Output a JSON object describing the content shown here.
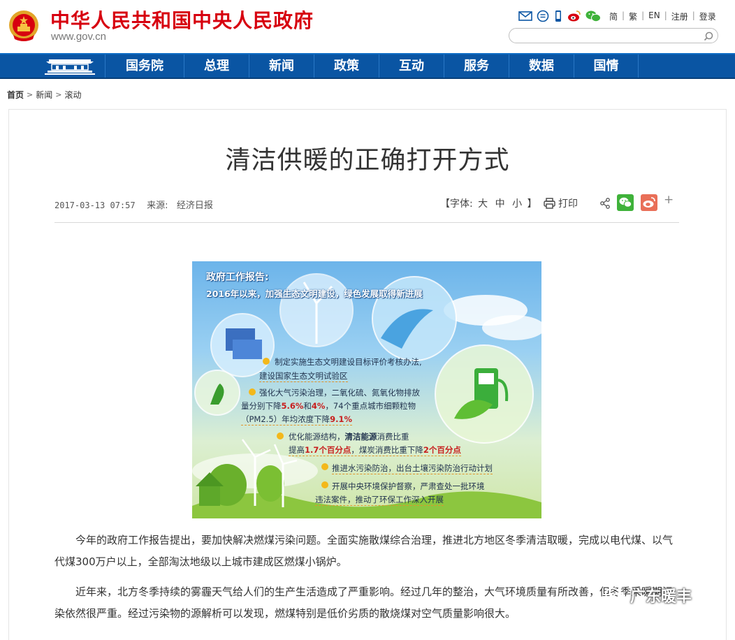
{
  "header": {
    "site_title": "中华人民共和国中央人民政府",
    "site_domain": "www.gov.cn",
    "lang_links": [
      "简",
      "繁",
      "EN",
      "注册",
      "登录"
    ],
    "search_placeholder": ""
  },
  "nav": {
    "items": [
      "国务院",
      "总理",
      "新闻",
      "政策",
      "互动",
      "服务",
      "数据",
      "国情"
    ]
  },
  "breadcrumb": {
    "items": [
      "首页",
      "新闻",
      "滚动"
    ]
  },
  "article": {
    "title": "清洁供暖的正确打开方式",
    "date": "2017-03-13 07:57",
    "source_label": "来源:",
    "source": "经济日报",
    "font_label_open": "【字体:",
    "font_sizes": [
      "大",
      "中",
      "小"
    ],
    "font_label_close": "】",
    "print_label": "打印",
    "plus_label": "+",
    "paragraphs": [
      "今年的政府工作报告提出，要加快解决燃煤污染问题。全面实施散煤综合治理，推进北方地区冬季清洁取暖，完成以电代煤、以气代煤300万户以上，全部淘汰地级以上城市建成区燃煤小锅炉。",
      "近年来，北方冬季持续的雾霾天气给人们的生产生活造成了严重影响。经过几年的整治，大气环境质量有所改善，但冬季采暖期污染依然很严重。经过污染物的源解析可以发现，燃煤特别是低价劣质的散烧煤对空气质量影响很大。"
    ]
  },
  "infographic": {
    "title": "政府工作报告:",
    "subtitle": "2016年以来，加强生态文明建设，绿色发展取得新进展",
    "item1_line1": "制定实施生态文明建设目标评价考核办法,",
    "item1_line2": "建设国家生态文明试验区",
    "item2_line1": "强化大气污染治理，二氧化硫、氮氧化物排放",
    "item2_line2_a": "量分别下降",
    "item2_line2_b": "5.6%",
    "item2_line2_c": "和",
    "item2_line2_d": "4%",
    "item2_line2_e": "，74个重点城市细颗粒物",
    "item2_line3_a": "（PM2.5）年均浓度下降",
    "item2_line3_b": "9.1%",
    "item3_line1_a": "优化能源结构，",
    "item3_line1_b": "清洁能源",
    "item3_line1_c": "消费比重",
    "item3_line2_a": "提高",
    "item3_line2_b": "1.7个百分点",
    "item3_line2_c": "，煤炭消费比重下降",
    "item3_line2_d": "2个百分点",
    "item4": "推进水污染防治，出台土壤污染防治行动计划",
    "item5_line1": "开展中央环境保护督察，严肃查处一批环境",
    "item5_line2": "违法案件，推动了环保工作深入开展"
  },
  "watermark": "广东暖丰",
  "colors": {
    "brand_red": "#d7000f",
    "nav_blue": "#0a55a3",
    "wechat_green": "#3fb23a",
    "weibo_orange": "#e96f58"
  }
}
